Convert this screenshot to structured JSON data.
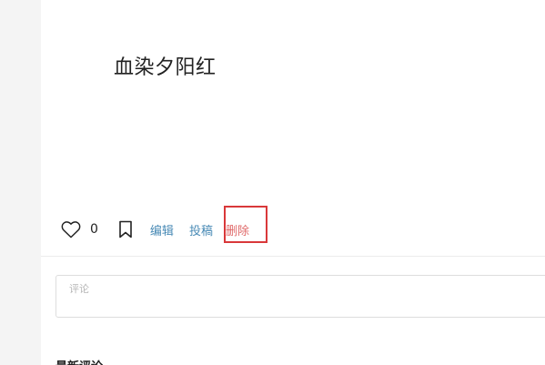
{
  "post": {
    "title": "血染夕阳红"
  },
  "actions": {
    "like_count": "0",
    "edit_label": "编辑",
    "submit_label": "投稿",
    "delete_label": "删除"
  },
  "comment": {
    "placeholder": "评论"
  },
  "sections": {
    "latest_comments_heading": "最新评论"
  },
  "icons": {
    "like": "heart-outline",
    "bookmark": "bookmark-outline"
  },
  "colors": {
    "link": "#4a8bb6",
    "delete": "#e06a6a",
    "highlight_border": "#d9383a",
    "gutter": "#f4f4f4"
  }
}
